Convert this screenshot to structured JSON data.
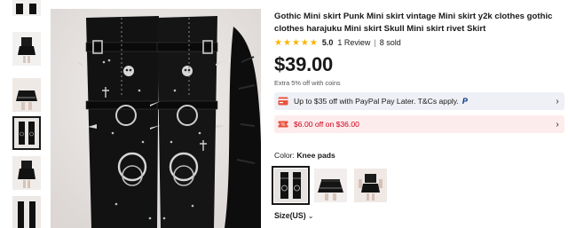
{
  "product": {
    "title": "Gothic Mini skirt Punk Mini skirt vintage Mini skirt y2k clothes gothic clothes harajuku Mini skirt Skull Mini skirt rivet Skirt",
    "rating": {
      "stars": 5,
      "value": "5.0",
      "reviews": "1 Review",
      "separator": "|",
      "sold": "8 sold",
      "star_color": "#fab400"
    },
    "price": "$39.00",
    "coins_note": "Extra 5% off with coins"
  },
  "promos": {
    "paypal": {
      "text": "Up to $35 off with PayPal Pay Later. T&Cs apply.",
      "logo": "P",
      "icon": "credit-card-icon"
    },
    "discount": {
      "text": "$6.00 off on $36.00",
      "icon": "coupon-icon",
      "color": "#d0011b"
    }
  },
  "color": {
    "label": "Color:",
    "selected": "Knee pads"
  },
  "size": {
    "label": "Size(US)"
  },
  "icons": {
    "chevron_right": "›",
    "chevron_down": "⌄",
    "star": "★"
  }
}
